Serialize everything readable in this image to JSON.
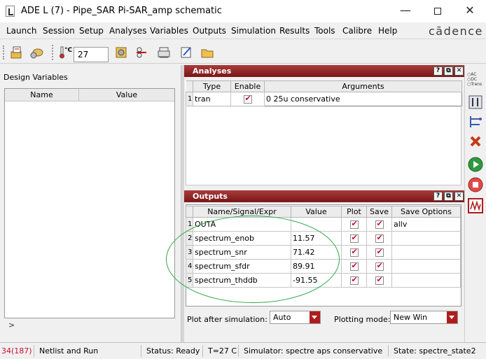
{
  "window": {
    "title": "ADE L (7) - Pipe_SAR Pi-SAR_amp schematic"
  },
  "menu": [
    "Launch",
    "Session",
    "Setup",
    "Analyses",
    "Variables",
    "Outputs",
    "Simulation",
    "Results",
    "Tools",
    "Calibre",
    "Help"
  ],
  "brand": "cādence",
  "toolbar": {
    "temp_unit": "°C",
    "temperature": "27"
  },
  "design_variables": {
    "title": "Design Variables",
    "columns": [
      "Name",
      "Value"
    ],
    "expand_arrow": ">"
  },
  "analyses": {
    "title": "Analyses",
    "columns": [
      "Type",
      "Enable",
      "Arguments"
    ],
    "rows": [
      {
        "n": "1",
        "type": "tran",
        "enabled": true,
        "args": "0 25u conservative"
      }
    ]
  },
  "outputs": {
    "title": "Outputs",
    "columns": [
      "Name/Signal/Expr",
      "Value",
      "Plot",
      "Save",
      "Save Options"
    ],
    "rows": [
      {
        "n": "1",
        "name": "OUTA",
        "value": "",
        "plot": true,
        "save": true,
        "options": "allv"
      },
      {
        "n": "2",
        "name": "spectrum_enob",
        "value": "11.57",
        "plot": true,
        "save": true,
        "options": ""
      },
      {
        "n": "3",
        "name": "spectrum_snr",
        "value": "71.42",
        "plot": true,
        "save": true,
        "options": ""
      },
      {
        "n": "4",
        "name": "spectrum_sfdr",
        "value": "89.91",
        "plot": true,
        "save": true,
        "options": ""
      },
      {
        "n": "5",
        "name": "spectrum_thddb",
        "value": "-91.55",
        "plot": true,
        "save": true,
        "options": ""
      }
    ],
    "plot_after_label": "Plot after simulation:",
    "plot_after_value": "Auto",
    "plotting_mode_label": "Plotting mode:",
    "plotting_mode_value": "New Win"
  },
  "right_tools": {
    "radio_labels": [
      "AC",
      "DC",
      "Trans"
    ]
  },
  "status": {
    "count": "34(187)",
    "action": "Netlist and Run",
    "state_text": "Status: Ready",
    "temp": "T=27 C",
    "simulator": "Simulator: spectre  aps  conservative",
    "state": "State: spectre_state2"
  },
  "colors": {
    "panel_title": "#8b2525",
    "check": "#c8102e",
    "annotation": "#2fa84a"
  }
}
